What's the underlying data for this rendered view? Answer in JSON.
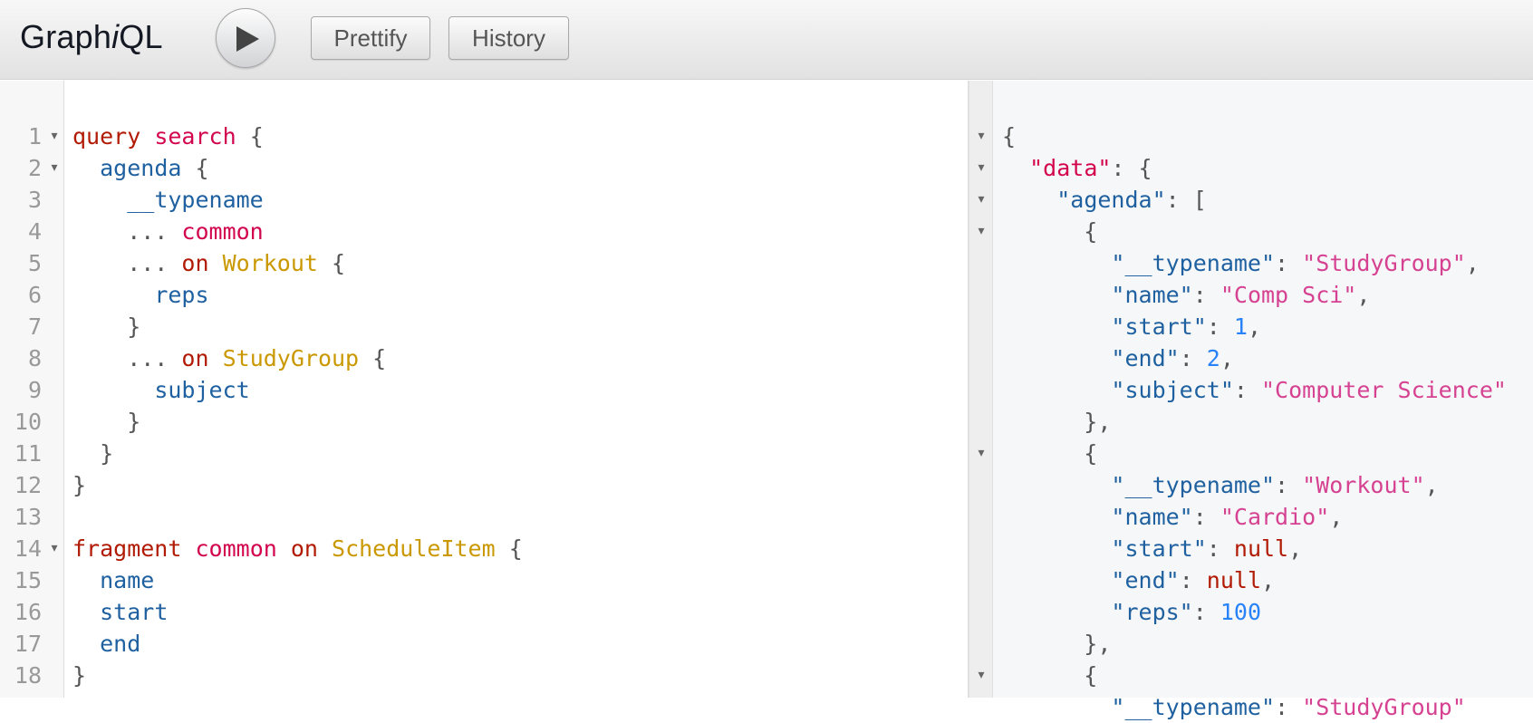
{
  "toolbar": {
    "logo_a": "Graph",
    "logo_i": "i",
    "logo_b": "QL",
    "prettify_label": "Prettify",
    "history_label": "History"
  },
  "editor": {
    "line_numbers": [
      "1",
      "2",
      "3",
      "4",
      "5",
      "6",
      "7",
      "8",
      "9",
      "10",
      "11",
      "12",
      "13",
      "14",
      "15",
      "16",
      "17",
      "18"
    ],
    "lines": [
      [
        {
          "t": "query",
          "c": "kw"
        },
        {
          "t": " ",
          "c": "pn"
        },
        {
          "t": "search",
          "c": "def"
        },
        {
          "t": " {",
          "c": "pn"
        }
      ],
      [
        {
          "t": "  ",
          "c": "pn"
        },
        {
          "t": "agenda",
          "c": "fld"
        },
        {
          "t": " ",
          "c": "pn"
        },
        {
          "t": "{",
          "c": "pn"
        }
      ],
      [
        {
          "t": "    ",
          "c": "pn"
        },
        {
          "t": "__typename",
          "c": "fld"
        }
      ],
      [
        {
          "t": "    ... ",
          "c": "pn"
        },
        {
          "t": "common",
          "c": "def"
        }
      ],
      [
        {
          "t": "    ... ",
          "c": "pn"
        },
        {
          "t": "on",
          "c": "kw"
        },
        {
          "t": " ",
          "c": "pn"
        },
        {
          "t": "Workout",
          "c": "typ"
        },
        {
          "t": " {",
          "c": "pn"
        }
      ],
      [
        {
          "t": "      ",
          "c": "pn"
        },
        {
          "t": "reps",
          "c": "fld"
        }
      ],
      [
        {
          "t": "    }",
          "c": "pn"
        }
      ],
      [
        {
          "t": "    ... ",
          "c": "pn"
        },
        {
          "t": "on",
          "c": "kw"
        },
        {
          "t": " ",
          "c": "pn"
        },
        {
          "t": "StudyGroup",
          "c": "typ"
        },
        {
          "t": " {",
          "c": "pn"
        }
      ],
      [
        {
          "t": "      ",
          "c": "pn"
        },
        {
          "t": "subject",
          "c": "fld"
        }
      ],
      [
        {
          "t": "    }",
          "c": "pn"
        }
      ],
      [
        {
          "t": "  ",
          "c": "pn"
        },
        {
          "t": "}",
          "c": "pn"
        }
      ],
      [
        {
          "t": "}",
          "c": "pn"
        }
      ],
      [],
      [
        {
          "t": "fragment",
          "c": "kw"
        },
        {
          "t": " ",
          "c": "pn"
        },
        {
          "t": "common",
          "c": "def"
        },
        {
          "t": " ",
          "c": "pn"
        },
        {
          "t": "on",
          "c": "kw"
        },
        {
          "t": " ",
          "c": "pn"
        },
        {
          "t": "ScheduleItem",
          "c": "typ"
        },
        {
          "t": " {",
          "c": "pn"
        }
      ],
      [
        {
          "t": "  ",
          "c": "pn"
        },
        {
          "t": "name",
          "c": "fld"
        }
      ],
      [
        {
          "t": "  ",
          "c": "pn"
        },
        {
          "t": "start",
          "c": "fld"
        }
      ],
      [
        {
          "t": "  ",
          "c": "pn"
        },
        {
          "t": "end",
          "c": "fld"
        }
      ],
      [
        {
          "t": "}",
          "c": "pn"
        }
      ]
    ],
    "fold_lines": [
      0,
      1,
      13
    ]
  },
  "result": {
    "lines": [
      [
        {
          "t": "{",
          "c": "pn"
        }
      ],
      [
        {
          "t": "  ",
          "c": "pn"
        },
        {
          "t": "\"data\"",
          "c": "def"
        },
        {
          "t": ": {",
          "c": "pn"
        }
      ],
      [
        {
          "t": "    ",
          "c": "pn"
        },
        {
          "t": "\"agenda\"",
          "c": "att"
        },
        {
          "t": ": [",
          "c": "pn"
        }
      ],
      [
        {
          "t": "      {",
          "c": "pn"
        }
      ],
      [
        {
          "t": "        ",
          "c": "pn"
        },
        {
          "t": "\"__typename\"",
          "c": "att"
        },
        {
          "t": ": ",
          "c": "pn"
        },
        {
          "t": "\"StudyGroup\"",
          "c": "str"
        },
        {
          "t": ",",
          "c": "pn"
        }
      ],
      [
        {
          "t": "        ",
          "c": "pn"
        },
        {
          "t": "\"name\"",
          "c": "att"
        },
        {
          "t": ": ",
          "c": "pn"
        },
        {
          "t": "\"Comp Sci\"",
          "c": "str"
        },
        {
          "t": ",",
          "c": "pn"
        }
      ],
      [
        {
          "t": "        ",
          "c": "pn"
        },
        {
          "t": "\"start\"",
          "c": "att"
        },
        {
          "t": ": ",
          "c": "pn"
        },
        {
          "t": "1",
          "c": "num"
        },
        {
          "t": ",",
          "c": "pn"
        }
      ],
      [
        {
          "t": "        ",
          "c": "pn"
        },
        {
          "t": "\"end\"",
          "c": "att"
        },
        {
          "t": ": ",
          "c": "pn"
        },
        {
          "t": "2",
          "c": "num"
        },
        {
          "t": ",",
          "c": "pn"
        }
      ],
      [
        {
          "t": "        ",
          "c": "pn"
        },
        {
          "t": "\"subject\"",
          "c": "att"
        },
        {
          "t": ": ",
          "c": "pn"
        },
        {
          "t": "\"Computer Science\"",
          "c": "str"
        }
      ],
      [
        {
          "t": "      },",
          "c": "pn"
        }
      ],
      [
        {
          "t": "      {",
          "c": "pn"
        }
      ],
      [
        {
          "t": "        ",
          "c": "pn"
        },
        {
          "t": "\"__typename\"",
          "c": "att"
        },
        {
          "t": ": ",
          "c": "pn"
        },
        {
          "t": "\"Workout\"",
          "c": "str"
        },
        {
          "t": ",",
          "c": "pn"
        }
      ],
      [
        {
          "t": "        ",
          "c": "pn"
        },
        {
          "t": "\"name\"",
          "c": "att"
        },
        {
          "t": ": ",
          "c": "pn"
        },
        {
          "t": "\"Cardio\"",
          "c": "str"
        },
        {
          "t": ",",
          "c": "pn"
        }
      ],
      [
        {
          "t": "        ",
          "c": "pn"
        },
        {
          "t": "\"start\"",
          "c": "att"
        },
        {
          "t": ": ",
          "c": "pn"
        },
        {
          "t": "null",
          "c": "nul"
        },
        {
          "t": ",",
          "c": "pn"
        }
      ],
      [
        {
          "t": "        ",
          "c": "pn"
        },
        {
          "t": "\"end\"",
          "c": "att"
        },
        {
          "t": ": ",
          "c": "pn"
        },
        {
          "t": "null",
          "c": "nul"
        },
        {
          "t": ",",
          "c": "pn"
        }
      ],
      [
        {
          "t": "        ",
          "c": "pn"
        },
        {
          "t": "\"reps\"",
          "c": "att"
        },
        {
          "t": ": ",
          "c": "pn"
        },
        {
          "t": "100",
          "c": "num"
        }
      ],
      [
        {
          "t": "      },",
          "c": "pn"
        }
      ],
      [
        {
          "t": "      {",
          "c": "pn"
        }
      ],
      [
        {
          "t": "        ",
          "c": "pn"
        },
        {
          "t": "\"__typename\"",
          "c": "att"
        },
        {
          "t": ": ",
          "c": "pn"
        },
        {
          "t": "\"StudyGroup\"",
          "c": "str"
        }
      ]
    ],
    "fold_lines": [
      0,
      1,
      2,
      3,
      10,
      17
    ]
  },
  "colors": {
    "keyword": "#b11a04",
    "definition": "#d2054e",
    "field": "#1f61a0",
    "type": "#ca9800",
    "string": "#d64292",
    "number": "#2882f9"
  },
  "icons": {
    "execute": "play-icon",
    "fold": "fold-arrow-icon"
  }
}
